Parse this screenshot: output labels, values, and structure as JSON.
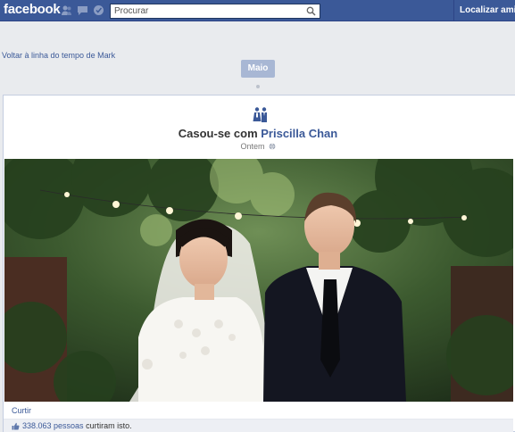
{
  "header": {
    "logo": "facebook",
    "search_placeholder": "Procurar",
    "find_friends": "Localizar amigos"
  },
  "back_link": "Voltar à linha do tempo de Mark",
  "timeline": {
    "month_label": "Maio"
  },
  "event": {
    "prefix": "Casou-se com ",
    "person": "Priscilla Chan",
    "date": "Ontem"
  },
  "actions": {
    "like": "Curtir"
  },
  "likes": {
    "count": "338.063 pessoas",
    "suffix": " curtiram isto."
  },
  "colors": {
    "brand": "#3b5998",
    "background": "#e9ebee",
    "month_pill": "#a8b7d4"
  }
}
